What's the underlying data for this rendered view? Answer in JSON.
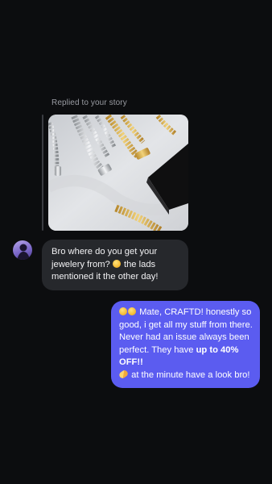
{
  "story_reply": {
    "label": "Replied to your story"
  },
  "incoming_message": {
    "text_part1": "Bro where do you get your jewelery from? ",
    "emoji1": "grinning-sweat-emoji",
    "text_part2": " the lads mentioned it the other day!"
  },
  "outgoing_message": {
    "emoji_start": "grinning-emojis",
    "text_part1": " Mate, CRAFTD! honestly so good, i get all my stuff from there. Never had an issue always been perfect. They have ",
    "bold_text": "up to 40% OFF!!",
    "emoji_mid": "pill-emoji",
    "text_part2": " at the minute have a look bro!"
  },
  "colors": {
    "background": "#0c0d0f",
    "incoming_bubble": "#26282c",
    "outgoing_bubble": "#5b5cf0"
  }
}
